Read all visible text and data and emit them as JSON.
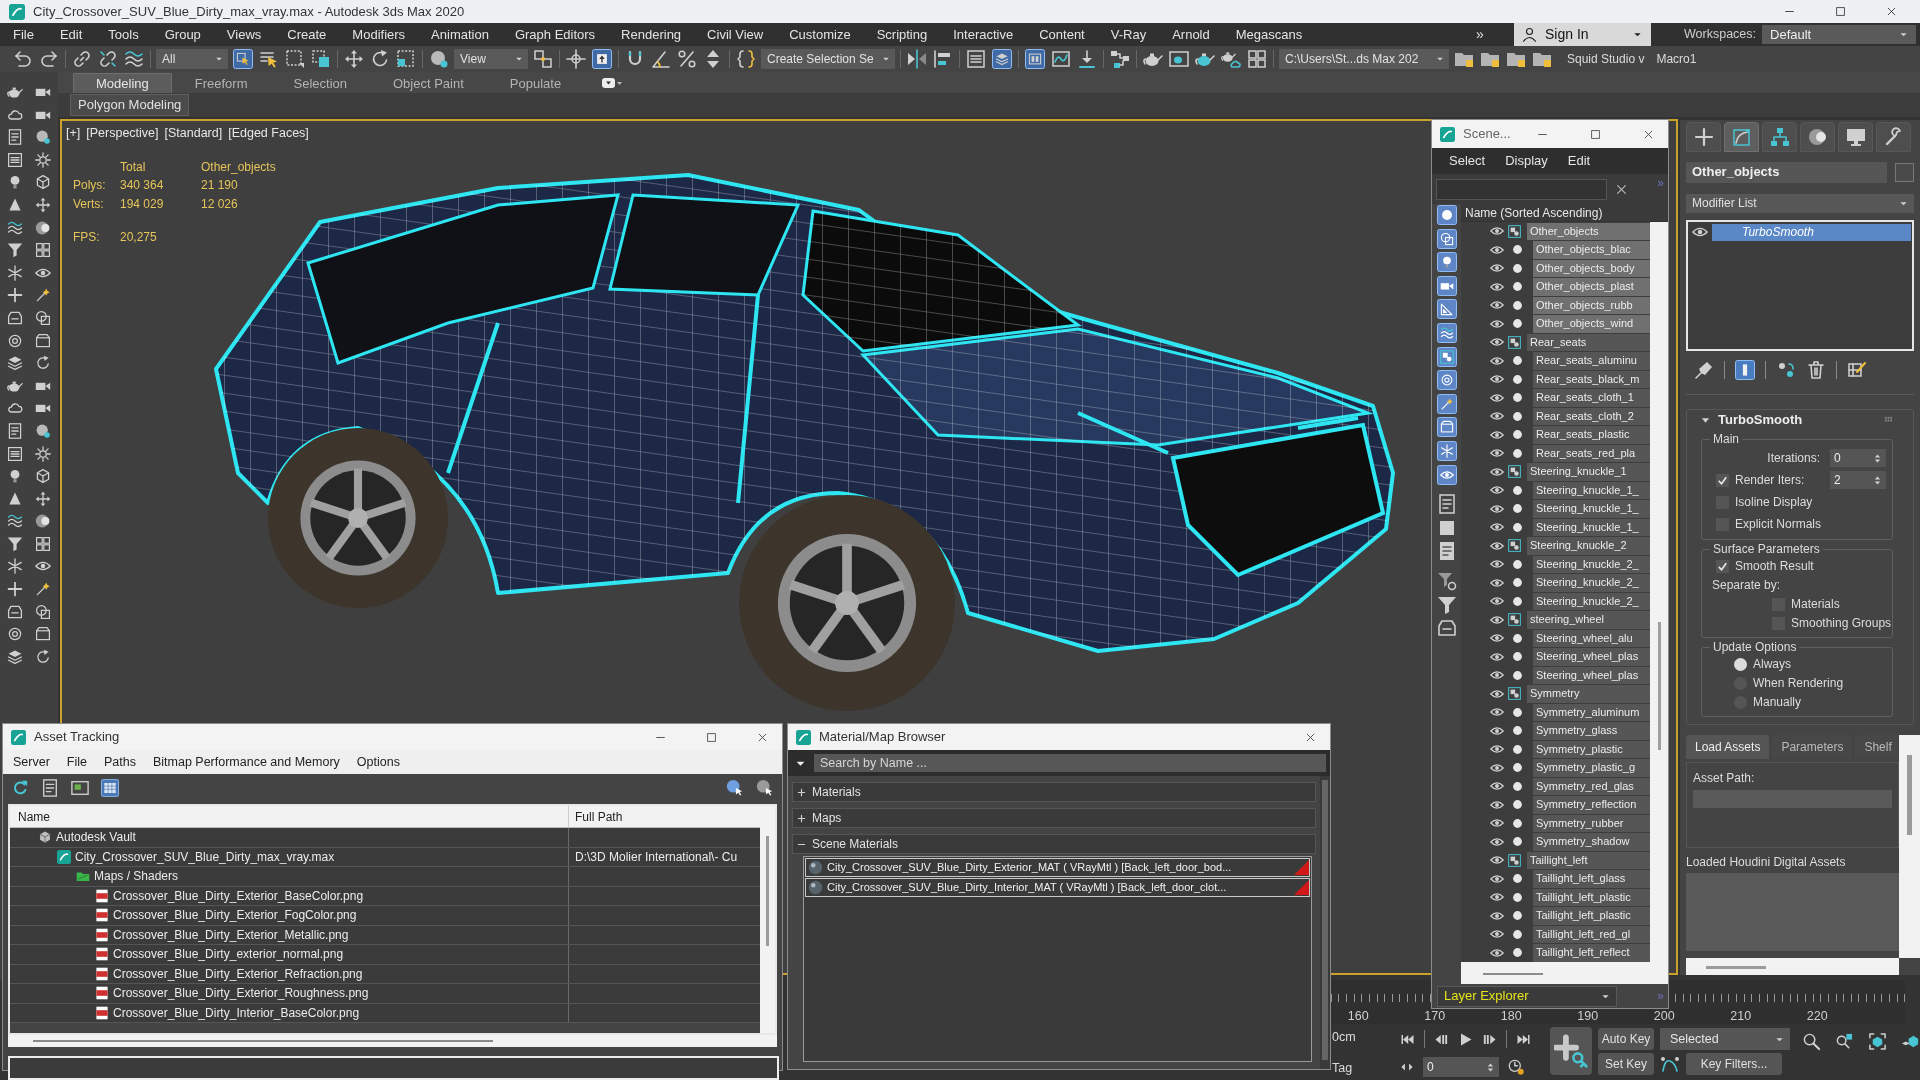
{
  "window": {
    "title": "City_Crossover_SUV_Blue_Dirty_max_vray.max - Autodesk 3ds Max 2020"
  },
  "menu_bar": {
    "items": [
      "File",
      "Edit",
      "Tools",
      "Group",
      "Views",
      "Create",
      "Modifiers",
      "Animation",
      "Graph Editors",
      "Rendering",
      "Civil View",
      "Customize",
      "Scripting",
      "Interactive",
      "Content",
      "V-Ray",
      "Arnold",
      "Megascans"
    ],
    "overflow": "»",
    "account": "Sign In",
    "workspaces_label": "Workspaces:",
    "workspace": "Default"
  },
  "main_toolbar": {
    "buttons": [
      {
        "selected": false
      },
      {
        "selected": false
      },
      {
        "selected": false
      },
      {
        "selected": false
      },
      {
        "selected": false
      },
      {
        "selected": true
      },
      {
        "selected": false
      },
      {
        "selected": false
      },
      {
        "selected": false
      },
      {
        "selected": false
      },
      {
        "selected": false
      },
      {
        "selected": false
      },
      {
        "selected": false
      },
      {
        "selected": false
      },
      {
        "selected": false
      },
      {
        "selected": true
      },
      {
        "selected": false
      },
      {
        "selected": false
      },
      {
        "selected": false
      },
      {
        "selected": false
      },
      {
        "selected": false
      },
      {
        "selected": false
      },
      {
        "selected": false
      },
      {
        "selected": false
      },
      {
        "selected": true
      },
      {
        "selected": true
      },
      {
        "selected": false
      },
      {
        "selected": false
      },
      {
        "selected": false
      },
      {
        "selected": false
      },
      {
        "selected": false
      },
      {
        "selected": false
      },
      {
        "selected": false
      },
      {
        "selected": false
      },
      {
        "selected": false
      },
      {
        "selected": false
      },
      {
        "selected": false
      },
      {
        "selected": false
      }
    ],
    "selection_filter": "All",
    "reference_coordinate_system": "View",
    "named_selection_set": "Create Selection Se",
    "project_folder": "C:\\Users\\St...ds Max 202",
    "macros": [
      "Squid Studio v",
      "Macro1"
    ]
  },
  "ribbon": {
    "tabs": [
      {
        "label": "Modeling",
        "selected": true
      },
      {
        "label": "Freeform",
        "selected": false
      },
      {
        "label": "Selection",
        "selected": false
      },
      {
        "label": "Object Paint",
        "selected": false
      },
      {
        "label": "Populate",
        "selected": false
      }
    ],
    "panel": "Polygon Modeling"
  },
  "viewport": {
    "labels": [
      "[+]",
      "[Perspective]",
      "[Standard]",
      "[Edged Faces]"
    ],
    "active": true,
    "statistics": {
      "columns": [
        "Total",
        "Other_objects"
      ],
      "rows": [
        {
          "label": "Polys:",
          "values": [
            "340 364",
            "21 190"
          ]
        },
        {
          "label": "Verts:",
          "values": [
            "194 029",
            "12 026"
          ]
        }
      ],
      "fps_label": "FPS:",
      "fps": "20,275"
    }
  },
  "scene_explorer": {
    "title": "Scene...",
    "menu": [
      "Select",
      "Display",
      "Edit"
    ],
    "more": "»",
    "filters": [
      {
        "selected": true
      },
      {
        "selected": true
      },
      {
        "selected": true
      },
      {
        "selected": true
      },
      {
        "selected": true
      },
      {
        "selected": true
      },
      {
        "selected": true
      },
      {
        "selected": true
      },
      {
        "selected": true
      },
      {
        "selected": true
      },
      {
        "selected": true
      },
      {
        "selected": true
      },
      {
        "selected": false
      },
      {
        "selected": false
      },
      {
        "selected": false
      },
      {
        "selected": false
      },
      {
        "selected": false
      },
      {
        "selected": false
      }
    ],
    "column": "Name (Sorted Ascending)",
    "rows": [
      {
        "name": "Other_objects",
        "kind": "layer",
        "selected": true
      },
      {
        "name": "Other_objects_blac",
        "kind": "object",
        "selected": true
      },
      {
        "name": "Other_objects_body",
        "kind": "object",
        "selected": true
      },
      {
        "name": "Other_objects_plast",
        "kind": "object",
        "selected": true
      },
      {
        "name": "Other_objects_rubb",
        "kind": "object",
        "selected": true
      },
      {
        "name": "Other_objects_wind",
        "kind": "object",
        "selected": true
      },
      {
        "name": "Rear_seats",
        "kind": "layer",
        "selected": false
      },
      {
        "name": "Rear_seats_aluminu",
        "kind": "object",
        "selected": false
      },
      {
        "name": "Rear_seats_black_m",
        "kind": "object",
        "selected": false
      },
      {
        "name": "Rear_seats_cloth_1",
        "kind": "object",
        "selected": false
      },
      {
        "name": "Rear_seats_cloth_2",
        "kind": "object",
        "selected": false
      },
      {
        "name": "Rear_seats_plastic",
        "kind": "object",
        "selected": false
      },
      {
        "name": "Rear_seats_red_pla",
        "kind": "object",
        "selected": false
      },
      {
        "name": "Steering_knuckle_1",
        "kind": "layer",
        "selected": false
      },
      {
        "name": "Steering_knuckle_1_",
        "kind": "object",
        "selected": false
      },
      {
        "name": "Steering_knuckle_1_",
        "kind": "object",
        "selected": false
      },
      {
        "name": "Steering_knuckle_1_",
        "kind": "object",
        "selected": false
      },
      {
        "name": "Steering_knuckle_2",
        "kind": "layer",
        "selected": false
      },
      {
        "name": "Steering_knuckle_2_",
        "kind": "object",
        "selected": false
      },
      {
        "name": "Steering_knuckle_2_",
        "kind": "object",
        "selected": false
      },
      {
        "name": "Steering_knuckle_2_",
        "kind": "object",
        "selected": false
      },
      {
        "name": "steering_wheel",
        "kind": "layer",
        "selected": false
      },
      {
        "name": "Steering_wheel_alu",
        "kind": "object",
        "selected": false
      },
      {
        "name": "Steering_wheel_plas",
        "kind": "object",
        "selected": false
      },
      {
        "name": "Steering_wheel_plas",
        "kind": "object",
        "selected": false
      },
      {
        "name": "Symmetry",
        "kind": "layer",
        "selected": false
      },
      {
        "name": "Symmetry_aluminum",
        "kind": "object",
        "selected": false
      },
      {
        "name": "Symmetry_glass",
        "kind": "object",
        "selected": false
      },
      {
        "name": "Symmetry_plastic",
        "kind": "object",
        "selected": false
      },
      {
        "name": "Symmetry_plastic_g",
        "kind": "object",
        "selected": false
      },
      {
        "name": "Symmetry_red_glas",
        "kind": "object",
        "selected": false
      },
      {
        "name": "Symmetry_reflection",
        "kind": "object",
        "selected": false
      },
      {
        "name": "Symmetry_rubber",
        "kind": "object",
        "selected": false
      },
      {
        "name": "Symmetry_shadow",
        "kind": "object",
        "selected": false
      },
      {
        "name": "Taillight_left",
        "kind": "layer",
        "selected": false
      },
      {
        "name": "Taillight_left_glass",
        "kind": "object",
        "selected": false
      },
      {
        "name": "Taillight_left_plastic",
        "kind": "object",
        "selected": false
      },
      {
        "name": "Taillight_left_plastic",
        "kind": "object",
        "selected": false
      },
      {
        "name": "Taillight_left_red_gl",
        "kind": "object",
        "selected": false
      },
      {
        "name": "Taillight_left_reflect",
        "kind": "object",
        "selected": false
      }
    ],
    "layer_dropdown": "Layer Explorer",
    "layer_more": "»"
  },
  "command_panel": {
    "tabs": [
      {
        "selected": false
      },
      {
        "selected": true
      },
      {
        "selected": false
      },
      {
        "selected": false
      },
      {
        "selected": false
      },
      {
        "selected": false
      }
    ],
    "object_name": "Other_objects",
    "modifier_list": "Modifier List",
    "stack": [
      {
        "name": "TurboSmooth",
        "selected": true
      }
    ],
    "stack_tools": [
      {
        "selected": false
      },
      {
        "selected": true
      },
      {
        "selected": false
      },
      {
        "selected": false
      },
      {
        "selected": false
      }
    ],
    "rollout": {
      "title": "TurboSmooth",
      "expanded": true,
      "groups": [
        {
          "title": "Main",
          "controls": [
            {
              "kind": "spinner",
              "label": "Iterations:",
              "value": "0"
            },
            {
              "kind": "check_spinner",
              "label": "Render Iters:",
              "checked": true,
              "value": "2"
            },
            {
              "kind": "checkbox",
              "label": "Isoline Display",
              "checked": false
            },
            {
              "kind": "checkbox",
              "label": "Explicit Normals",
              "checked": false
            }
          ]
        },
        {
          "title": "Surface Parameters",
          "controls": [
            {
              "kind": "checkbox",
              "label": "Smooth Result",
              "checked": true
            },
            {
              "kind": "text",
              "label": "Separate by:"
            },
            {
              "kind": "indented_checkbox",
              "label": "Materials",
              "checked": false
            },
            {
              "kind": "indented_checkbox",
              "label": "Smoothing Groups",
              "checked": false
            }
          ]
        },
        {
          "title": "Update Options",
          "controls": [
            {
              "kind": "radio",
              "label": "Always",
              "selected": true
            },
            {
              "kind": "radio",
              "label": "When Rendering",
              "selected": false
            },
            {
              "kind": "radio",
              "label": "Manually",
              "selected": false
            }
          ]
        }
      ]
    }
  },
  "houdini_panel": {
    "tabs": [
      {
        "label": "Load Assets",
        "selected": true
      },
      {
        "label": "Parameters",
        "selected": false
      },
      {
        "label": "Shelf",
        "selected": false
      }
    ],
    "asset_path_label": "Asset Path:",
    "loaded_label": "Loaded Houdini Digital Assets"
  },
  "asset_tracking": {
    "title": "Asset Tracking",
    "menu": [
      "Server",
      "File",
      "Paths",
      "Bitmap Performance and Memory",
      "Options"
    ],
    "tools": [
      {
        "selected": false
      },
      {
        "selected": false
      },
      {
        "selected": false
      },
      {
        "selected": true
      }
    ],
    "columns": [
      "Name",
      "Full Path"
    ],
    "tree": [
      {
        "name": "Autodesk Vault",
        "kind": "vault",
        "children": [
          {
            "name": "City_Crossover_SUV_Blue_Dirty_max_vray.max",
            "kind": "scene",
            "path": "D:\\3D Molier International\\- Cu",
            "children": [
              {
                "name": "Maps / Shaders",
                "kind": "folder",
                "children": [
                  {
                    "name": "Crossover_Blue_Dirty_Exterior_BaseColor.png",
                    "kind": "image"
                  },
                  {
                    "name": "Crossover_Blue_Dirty_Exterior_FogColor.png",
                    "kind": "image"
                  },
                  {
                    "name": "Crossover_Blue_Dirty_Exterior_Metallic.png",
                    "kind": "image"
                  },
                  {
                    "name": "Crossover_Blue_Dirty_exterior_normal.png",
                    "kind": "image"
                  },
                  {
                    "name": "Crossover_Blue_Dirty_Exterior_Refraction.png",
                    "kind": "image"
                  },
                  {
                    "name": "Crossover_Blue_Dirty_Exterior_Roughness.png",
                    "kind": "image"
                  },
                  {
                    "name": "Crossover_Blue_Dirty_Interior_BaseColor.png",
                    "kind": "image"
                  }
                ]
              }
            ]
          }
        ]
      }
    ]
  },
  "material_browser": {
    "title": "Material/Map Browser",
    "search_placeholder": "Search by Name ...",
    "groups": [
      {
        "label": "Materials",
        "expanded": false
      },
      {
        "label": "Maps",
        "expanded": false
      },
      {
        "label": "Scene Materials",
        "expanded": true,
        "items": [
          "City_Crossover_SUV_Blue_Dirty_Exterior_MAT ( VRayMtl ) [Back_left_door_bod...",
          "City_Crossover_SUV_Blue_Dirty_Interior_MAT ( VRayMtl ) [Back_left_door_clot..."
        ]
      }
    ]
  },
  "timeline": {
    "ticks": [
      "160",
      "170",
      "180",
      "190",
      "200",
      "210",
      "220"
    ]
  },
  "status_bar": {
    "coordinate": "0cm",
    "tag": "Tag"
  },
  "animation_controls": {
    "frame": "0",
    "auto_key": "Auto Key",
    "set_key": "Set Key",
    "key_set": "Selected",
    "key_filters": "Key Filters..."
  }
}
